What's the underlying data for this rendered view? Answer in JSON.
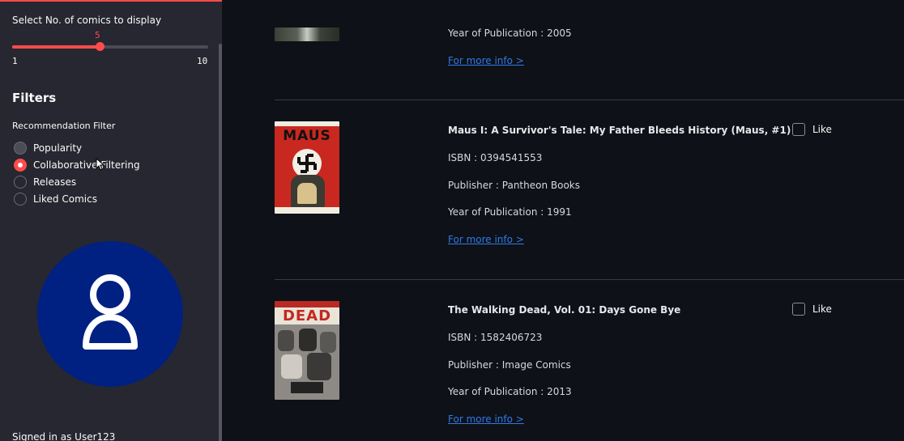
{
  "sidebar": {
    "slider_label": "Select No. of comics to display",
    "slider_value": 5,
    "slider_min": "1",
    "slider_max": "10",
    "filters_heading": "Filters",
    "recommendation_filter_label": "Recommendation Filter",
    "radio_options": [
      {
        "label": "Popularity",
        "checked": false
      },
      {
        "label": "Collaborative Filtering",
        "checked": true
      },
      {
        "label": "Releases",
        "checked": false
      },
      {
        "label": "Liked Comics",
        "checked": false
      }
    ],
    "avatar_icon": "user-icon",
    "signed_in_text": "Signed in as User123"
  },
  "comics": [
    {
      "year": "Year of Publication : 2005",
      "link": "For more info >"
    },
    {
      "title": "Maus I: A Survivor's Tale: My Father Bleeds History (Maus, #1)",
      "isbn": "ISBN : 0394541553",
      "publisher": "Publisher : Pantheon Books",
      "year": "Year of Publication : 1991",
      "link": "For more info >",
      "like_label": "Like",
      "cover_text": "MAUS"
    },
    {
      "title": "The Walking Dead, Vol. 01: Days Gone Bye",
      "isbn": "ISBN : 1582406723",
      "publisher": "Publisher : Image Comics",
      "year": "Year of Publication : 2013",
      "link": "For more info >",
      "like_label": "Like",
      "cover_text": "DEAD"
    }
  ],
  "colors": {
    "accent": "#ff4b4b",
    "avatar_bg": "#002082",
    "link": "#2f7ae8"
  }
}
